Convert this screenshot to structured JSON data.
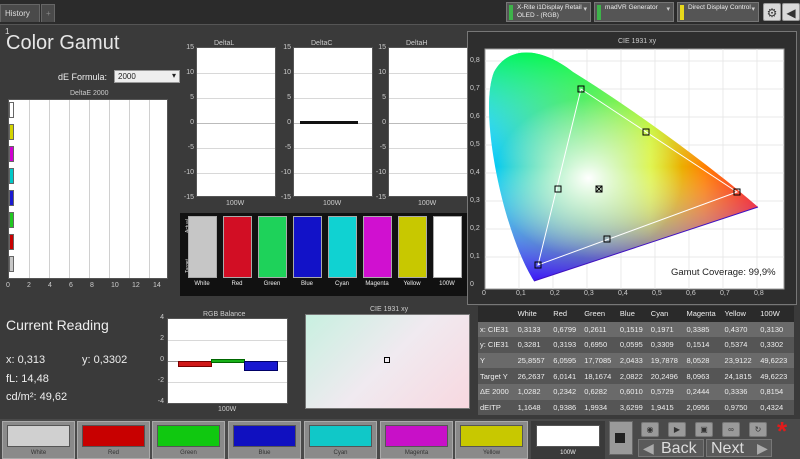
{
  "tabs": [
    {
      "label": "History 1"
    },
    {
      "label": "+"
    }
  ],
  "devices": [
    {
      "line1": "X-Rite i1Display Retail",
      "line2": "OLED - (RGB)",
      "color": "#3db34a"
    },
    {
      "line1": "madVR Generator",
      "line2": "",
      "color": "#3db34a"
    },
    {
      "line1": "Direct Display Control",
      "line2": "",
      "color": "#e8d91b"
    }
  ],
  "title": "Color Gamut",
  "formula": {
    "label": "dE Formula:",
    "value": "2000"
  },
  "deltae": {
    "title": "DeltaE 2000",
    "xticks": [
      "0",
      "2",
      "4",
      "6",
      "8",
      "10",
      "12",
      "14"
    ],
    "bars": [
      {
        "color": "#ffffff"
      },
      {
        "color": "#d4d400"
      },
      {
        "color": "#d000d0"
      },
      {
        "color": "#00c8c8"
      },
      {
        "color": "#1a1ad0"
      },
      {
        "color": "#20c820"
      },
      {
        "color": "#c80000"
      },
      {
        "color": "#c8c8c8"
      }
    ]
  },
  "delta_charts": [
    {
      "title": "DeltaL",
      "xlabel": "100W",
      "yticks": [
        "15",
        "10",
        "5",
        "0",
        "-5",
        "-10",
        "-15"
      ]
    },
    {
      "title": "DeltaC",
      "xlabel": "100W",
      "yticks": [
        "15",
        "10",
        "5",
        "0",
        "-5",
        "-10",
        "-15"
      ]
    },
    {
      "title": "DeltaH",
      "xlabel": "100W",
      "yticks": [
        "15",
        "10",
        "5",
        "0",
        "-5",
        "-10",
        "-15"
      ]
    }
  ],
  "swatches": {
    "actual_label": "Actual",
    "target_label": "Target",
    "items": [
      {
        "label": "White",
        "color": "#c6c6c6"
      },
      {
        "label": "Red",
        "color": "#d20e24"
      },
      {
        "label": "Green",
        "color": "#1ed25a"
      },
      {
        "label": "Blue",
        "color": "#1212c8"
      },
      {
        "label": "Cyan",
        "color": "#10d2d2"
      },
      {
        "label": "Magenta",
        "color": "#d010d0"
      },
      {
        "label": "Yellow",
        "color": "#c8c800"
      },
      {
        "label": "100W",
        "color": "#ffffff"
      }
    ]
  },
  "cie": {
    "title": "CIE 1931 xy",
    "xticks": [
      "0",
      "0,1",
      "0,2",
      "0,3",
      "0,4",
      "0,5",
      "0,6",
      "0,7",
      "0,8"
    ],
    "yticks": [
      "0,8",
      "0,7",
      "0,6",
      "0,5",
      "0,4",
      "0,3",
      "0,2",
      "0,1",
      "0"
    ],
    "gamut_label": "Gamut Coverage:",
    "gamut_value": "99,9%"
  },
  "cie_small_title": "CIE 1931 xy",
  "current": {
    "title": "Current Reading",
    "x_label": "x:",
    "x_value": "0,313",
    "y_label": "y:",
    "y_value": "0,3302",
    "fl_label": "fL:",
    "fl_value": "14,48",
    "cdm_label": "cd/m²:",
    "cdm_value": "49,62"
  },
  "rgb_balance": {
    "title": "RGB Balance",
    "xlabel": "100W",
    "yticks": [
      "4",
      "2",
      "0",
      "-2",
      "-4"
    ]
  },
  "table": {
    "headers": [
      "",
      "White",
      "Red",
      "Green",
      "Blue",
      "Cyan",
      "Magenta",
      "Yellow",
      "100W"
    ],
    "rows": [
      [
        "x: CIE31",
        "0,3133",
        "0,6799",
        "0,2611",
        "0,1519",
        "0,1971",
        "0,3385",
        "0,4370",
        "0,3130"
      ],
      [
        "y: CIE31",
        "0,3281",
        "0,3193",
        "0,6950",
        "0,0595",
        "0,3309",
        "0,1514",
        "0,5374",
        "0,3302"
      ],
      [
        "Y",
        "25,8557",
        "6,0595",
        "17,7085",
        "2,0433",
        "19,7878",
        "8,0528",
        "23,9122",
        "49,6223"
      ],
      [
        "Target Y",
        "26,2637",
        "6,0141",
        "18,1674",
        "2,0822",
        "20,2496",
        "8,0963",
        "24,1815",
        "49,6223"
      ],
      [
        "ΔE 2000",
        "1,0282",
        "0,2342",
        "0,6282",
        "0,6010",
        "0,5729",
        "0,2444",
        "0,3336",
        "0,8154"
      ],
      [
        "dEITP",
        "1,1648",
        "0,9386",
        "1,9934",
        "3,6299",
        "1,9415",
        "2,0956",
        "0,9750",
        "0,4324"
      ]
    ]
  },
  "bottom": [
    {
      "label": "White",
      "color": "#d0d0d0"
    },
    {
      "label": "Red",
      "color": "#c80000"
    },
    {
      "label": "Green",
      "color": "#10c810"
    },
    {
      "label": "Blue",
      "color": "#1010c0"
    },
    {
      "label": "Cyan",
      "color": "#10c8c8"
    },
    {
      "label": "Magenta",
      "color": "#c810c8"
    },
    {
      "label": "Yellow",
      "color": "#c8c800"
    },
    {
      "label": "100W",
      "color": "#ffffff"
    }
  ],
  "nav": {
    "back": "Back",
    "next": "Next"
  }
}
